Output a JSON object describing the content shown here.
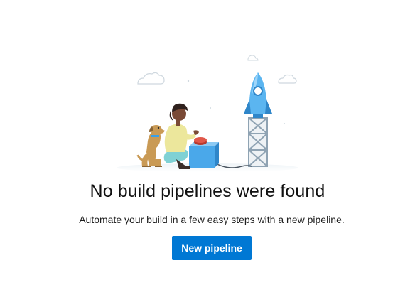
{
  "empty_state": {
    "title": "No build pipelines were found",
    "subtitle": "Automate your build in a few easy steps with a new pipeline.",
    "button_label": "New pipeline"
  },
  "illustration": {
    "subjects": [
      "person-icon",
      "dog-icon",
      "rocket-icon",
      "launch-tower-icon",
      "cloud-icon",
      "button-box-icon"
    ],
    "colors": {
      "rocket": "#3aa0e8",
      "box": "#3aa0e8",
      "button_red": "#d9483b",
      "shirt": "#e8e39a",
      "dog": "#c99a55",
      "tower": "#9bb0bf",
      "cloud_outline": "#cfd8df"
    }
  },
  "colors": {
    "primary": "#0078d4",
    "text": "#111111"
  }
}
